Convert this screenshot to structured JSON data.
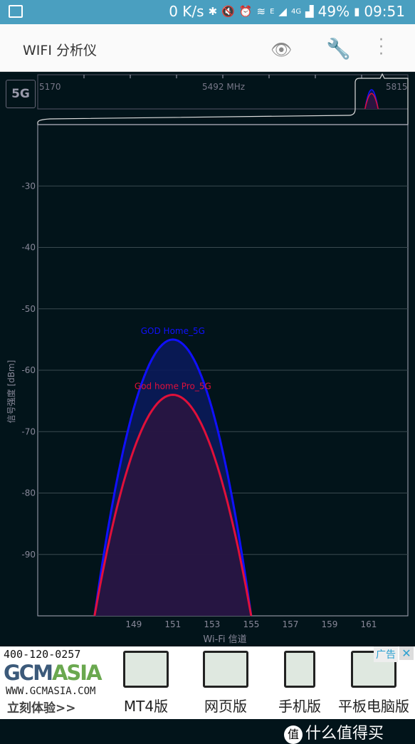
{
  "status_bar": {
    "speed": "0 K/s",
    "network_e": "E",
    "network_4g": "4G",
    "battery": "49%",
    "time": "09:51"
  },
  "app_bar": {
    "title": "WIFI 分析仪",
    "icons": [
      "eye-icon",
      "wrench-icon",
      "more-vert-icon"
    ]
  },
  "band_button": "5G",
  "overview": {
    "freq_start": "5170",
    "freq_mid": "5492 MHz",
    "freq_end": "5815"
  },
  "chart_data": {
    "type": "area",
    "xlabel": "Wi-Fi 信道",
    "ylabel": "信号强度 [dBm]",
    "xlim": [
      144.1,
      163
    ],
    "ylim": [
      -100,
      -20
    ],
    "xticks": [
      149,
      151,
      153,
      155,
      157,
      159,
      161
    ],
    "yticks": [
      -30,
      -40,
      -50,
      -60,
      -70,
      -80,
      -90
    ],
    "grid": true,
    "series": [
      {
        "name": "GOD Home_5G",
        "channel": 151,
        "channel_span": [
          147,
          155
        ],
        "peak_dbm": -55,
        "color": "#1010ff",
        "fill": "#0a1a5a"
      },
      {
        "name": "God home Pro_5G",
        "channel": 151,
        "channel_span": [
          147,
          155
        ],
        "peak_dbm": -64,
        "color": "#e0103a",
        "fill": "#2a1540"
      }
    ]
  },
  "ad": {
    "tag": "广告",
    "close": "✕",
    "phone": "400-120-0257",
    "logo_a": "GCM",
    "logo_b": "ASIA",
    "url": "WWW.GCMASIA.COM",
    "cta": "立刻体验>>",
    "products": [
      "MT4版",
      "网页版",
      "手机版",
      "平板电脑版"
    ]
  },
  "watermark": {
    "icon": "值",
    "text": "什么值得买"
  }
}
